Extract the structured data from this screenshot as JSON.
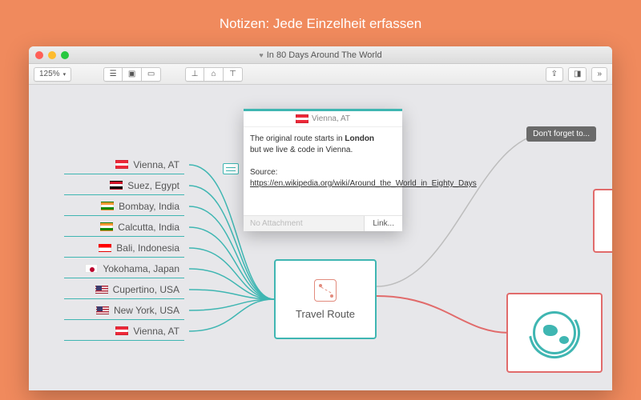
{
  "page_heading": "Notizen: Jede Einzelheit erfassen",
  "window": {
    "title": "In 80 Days Around The World"
  },
  "toolbar": {
    "zoom": "125%"
  },
  "central_node": {
    "label": "Travel Route"
  },
  "list_items": [
    {
      "flag": "at",
      "label": "Vienna, AT"
    },
    {
      "flag": "eg",
      "label": "Suez, Egypt"
    },
    {
      "flag": "in",
      "label": "Bombay, India"
    },
    {
      "flag": "in",
      "label": "Calcutta, India"
    },
    {
      "flag": "id",
      "label": "Bali, Indonesia"
    },
    {
      "flag": "jp",
      "label": "Yokohama, Japan"
    },
    {
      "flag": "us",
      "label": "Cupertino, USA"
    },
    {
      "flag": "us",
      "label": "New York, USA"
    },
    {
      "flag": "at",
      "label": "Vienna, AT"
    }
  ],
  "tag": {
    "label": "Don't forget to..."
  },
  "popover": {
    "header_label": "Vienna, AT",
    "body_line1_a": "The original route starts in ",
    "body_line1_b": "London",
    "body_line2": "but we live & code in Vienna.",
    "body_source_prefix": "Source: ",
    "body_link": "https://en.wikipedia.org/wiki/Around_the_World_in_Eighty_Days",
    "attachment_placeholder": "No Attachment",
    "link_button": "Link..."
  }
}
